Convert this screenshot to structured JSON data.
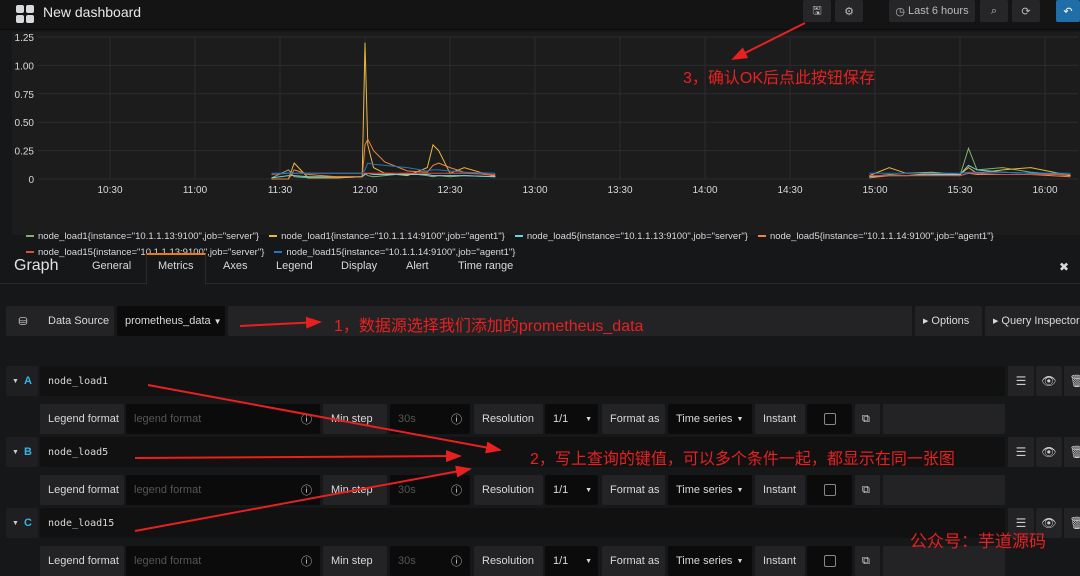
{
  "header": {
    "title": "New dashboard",
    "time_range": "Last 6 hours",
    "icons": [
      "save-icon",
      "gear-icon",
      "clock-icon",
      "zoom-out-icon",
      "refresh-icon",
      "back-icon"
    ]
  },
  "chart_data": {
    "type": "line",
    "ylim": [
      0,
      1.25
    ],
    "yticks": [
      "0",
      "0.25",
      "0.50",
      "0.75",
      "1.00",
      "1.25"
    ],
    "xticks": [
      "10:30",
      "11:00",
      "11:30",
      "12:00",
      "12:30",
      "13:00",
      "13:30",
      "14:00",
      "14:30",
      "15:00",
      "15:30",
      "16:00"
    ],
    "x": [
      "11:27",
      "11:33",
      "11:35",
      "11:40",
      "11:50",
      "11:59",
      "12:00",
      "12:01",
      "12:03",
      "12:07",
      "12:15",
      "12:22",
      "12:24",
      "12:26",
      "12:30",
      "12:35",
      "12:46",
      "14:58",
      "15:05",
      "15:11",
      "15:20",
      "15:30",
      "15:33",
      "15:36",
      "15:45",
      "15:55",
      "16:09"
    ],
    "series": [
      {
        "name": "node_load1{instance=\"10.1.1.13:9100\",job=\"server\"}",
        "color": "#7eb26d",
        "values": [
          0.01,
          0.08,
          0.02,
          0.01,
          0.01,
          0.02,
          0.05,
          0.03,
          0.02,
          0.03,
          0.05,
          0.03,
          0.02,
          0.03,
          0.02,
          0.03,
          0.02,
          0.02,
          0.04,
          0.03,
          0.05,
          0.03,
          0.27,
          0.08,
          0.1,
          0.06,
          0.03
        ]
      },
      {
        "name": "node_load1{instance=\"10.1.1.14:9100\",job=\"agent1\"}",
        "color": "#eab839",
        "values": [
          0,
          0,
          0.14,
          0.01,
          0.01,
          0.02,
          1.2,
          0.3,
          0.1,
          0.05,
          0.03,
          0.1,
          0.3,
          0.25,
          0.05,
          0.1,
          0.02,
          0.03,
          0.1,
          0.05,
          0.06,
          0.04,
          0.1,
          0.05,
          0.08,
          0.1,
          0.03
        ]
      },
      {
        "name": "node_load5{instance=\"10.1.1.13:9100\",job=\"server\"}",
        "color": "#6ed0e0",
        "values": [
          0.01,
          0.03,
          0.03,
          0.02,
          0.02,
          0.02,
          0.04,
          0.05,
          0.04,
          0.04,
          0.04,
          0.04,
          0.03,
          0.03,
          0.03,
          0.03,
          0.02,
          0.02,
          0.03,
          0.03,
          0.04,
          0.04,
          0.12,
          0.08,
          0.06,
          0.05,
          0.04
        ]
      },
      {
        "name": "node_load5{instance=\"10.1.1.14:9100\",job=\"agent1\"}",
        "color": "#ef843c",
        "values": [
          0,
          0,
          0.08,
          0.04,
          0.02,
          0.02,
          0.3,
          0.35,
          0.25,
          0.15,
          0.07,
          0.06,
          0.12,
          0.14,
          0.1,
          0.06,
          0.03,
          0.01,
          0.03,
          0.03,
          0.03,
          0.03,
          0.05,
          0.04,
          0.04,
          0.04,
          0.02
        ]
      },
      {
        "name": "node_load15{instance=\"10.1.1.13:9100\",job=\"server\"}",
        "color": "#e24d42",
        "values": [
          0.04,
          0.05,
          0.05,
          0.05,
          0.05,
          0.05,
          0.05,
          0.05,
          0.05,
          0.05,
          0.05,
          0.05,
          0.05,
          0.05,
          0.05,
          0.05,
          0.04,
          0.03,
          0.03,
          0.03,
          0.03,
          0.03,
          0.05,
          0.05,
          0.04,
          0.04,
          0.04
        ]
      },
      {
        "name": "node_load15{instance=\"10.1.1.14:9100\",job=\"agent1\"}",
        "color": "#1f78c1",
        "values": [
          0.05,
          0.05,
          0.05,
          0.05,
          0.05,
          0.05,
          0.08,
          0.14,
          0.13,
          0.12,
          0.1,
          0.07,
          0.08,
          0.08,
          0.07,
          0.06,
          0.05,
          0.05,
          0.05,
          0.05,
          0.05,
          0.05,
          0.06,
          0.06,
          0.06,
          0.05,
          0.05
        ]
      }
    ],
    "legend": "bottom"
  },
  "editor": {
    "title": "Graph",
    "tabs": [
      "General",
      "Metrics",
      "Axes",
      "Legend",
      "Display",
      "Alert",
      "Time range"
    ],
    "active_tab": "Metrics",
    "close": "✖",
    "data_source_label": "Data Source",
    "data_source_value": "prometheus_data",
    "options": "Options",
    "query_inspector": "Query Inspector",
    "queries": [
      {
        "letter": "A",
        "expr": "node_load1"
      },
      {
        "letter": "B",
        "expr": "node_load5"
      },
      {
        "letter": "C",
        "expr": "node_load15"
      }
    ],
    "fields": {
      "legend_format": "Legend format",
      "legend_placeholder": "legend format",
      "min_step": "Min step",
      "min_step_placeholder": "30s",
      "resolution": "Resolution",
      "resolution_value": "1/1",
      "format_as": "Format as",
      "format_value": "Time series",
      "instant": "Instant"
    }
  },
  "annotations": {
    "step1": "1，数据源选择我们添加的prometheus_data",
    "step2": "2，写上查询的键值，可以多个条件一起，都显示在同一张图",
    "step3": "3，确认OK后点此按钮保存",
    "watermark": "公众号：芋道源码",
    "color": "#e82020"
  }
}
